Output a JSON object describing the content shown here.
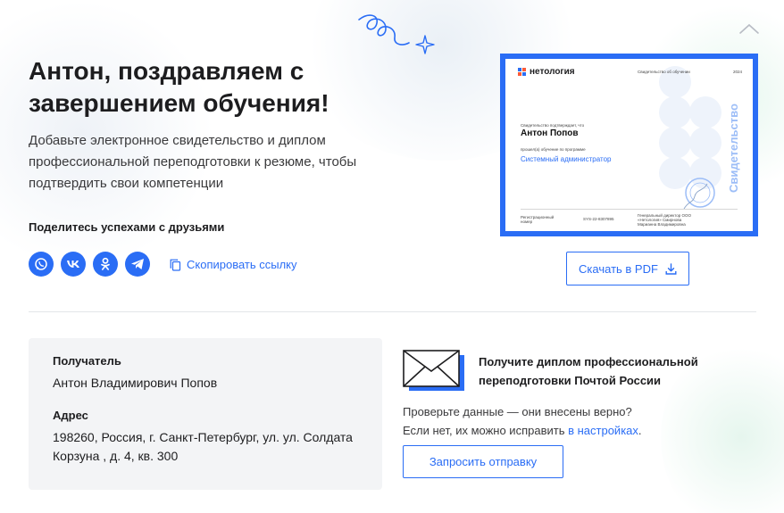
{
  "header": {
    "title": "Антон, поздравляем с завершением обучения!",
    "subtitle": "Добавьте электронное свидетельство и диплом профессиональной переподготовки к резюме, чтобы подтвердить свои компетенции"
  },
  "share": {
    "heading": "Поделитесь успехами с друзьями",
    "networks": [
      "whatsapp-icon",
      "vk-icon",
      "odnoklassniki-icon",
      "telegram-icon"
    ],
    "copy_label": "Скопировать ссылку"
  },
  "certificate": {
    "brand": "нетология",
    "doc_label": "Свидетельство об обучении",
    "year": "2024",
    "confirm_label": "Свидетельство подтверждает, что",
    "student_name": "Антон Попов",
    "studied_label": "прошел(а) обучение по программе",
    "program": "Системный администратор",
    "reg_label": "Регистрационный номер",
    "reg_number": "SYS-22-8307895",
    "director": "Генеральный директор ООО «Нетология» Смирнова Марианна Владимировна",
    "vertical_text": "Свидетельство"
  },
  "download": {
    "label": "Скачать в PDF"
  },
  "recipient": {
    "recipient_label": "Получатель",
    "recipient_value": "Антон Владимирович Попов",
    "address_label": "Адрес",
    "address_value": "198260, Россия, г. Санкт-Петербург, ул. ул. Солдата Корзуна , д. 4, кв. 300"
  },
  "mail": {
    "title": "Получите диплом профессиональной переподготовки Почтой России",
    "text_line1": "Проверьте данные — они внесены верно?",
    "text_line2_before": "Если нет, их можно исправить ",
    "text_link": "в настройках",
    "text_line2_after": ".",
    "request_label": "Запросить отправку"
  },
  "colors": {
    "accent": "#2a6df5",
    "text": "#1d1d1f",
    "panel": "#f3f4f6"
  }
}
